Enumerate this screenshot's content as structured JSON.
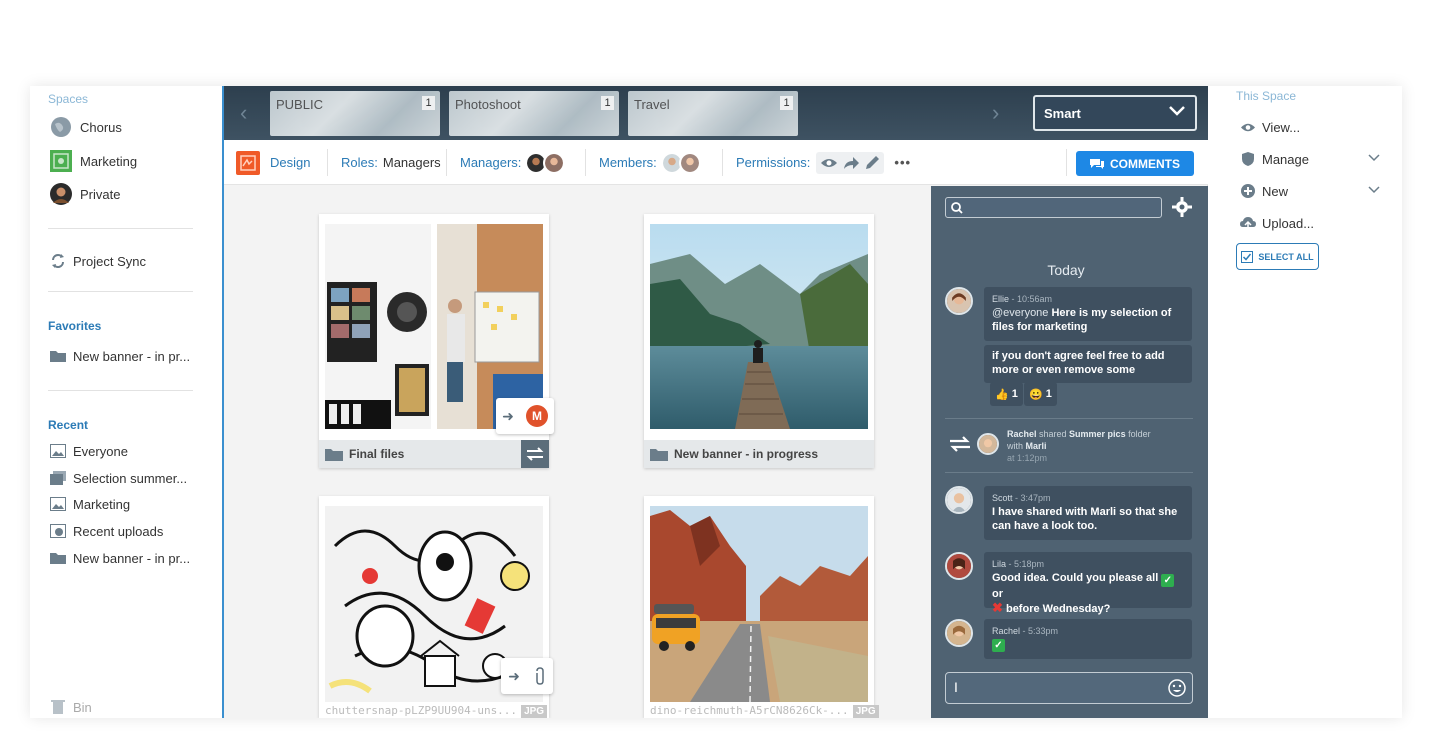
{
  "sidebar": {
    "spaces_heading": "Spaces",
    "spaces": [
      {
        "label": "Chorus",
        "icon": "globe-icon"
      },
      {
        "label": "Marketing",
        "icon": "marketing-space-icon"
      },
      {
        "label": "Private",
        "icon": "avatar"
      }
    ],
    "project_sync": "Project Sync",
    "favorites_heading": "Favorites",
    "favorites": [
      {
        "label": "New banner - in pr...",
        "icon": "folder-icon"
      }
    ],
    "recent_heading": "Recent",
    "recent": [
      {
        "label": "Everyone",
        "icon": "image-icon"
      },
      {
        "label": "Selection summer...",
        "icon": "stack-icon"
      },
      {
        "label": "Marketing",
        "icon": "image-icon"
      },
      {
        "label": "Recent uploads",
        "icon": "upload-clock-icon"
      },
      {
        "label": "New banner - in pr...",
        "icon": "folder-icon"
      }
    ],
    "bin": "Bin"
  },
  "tabs": [
    {
      "label": "PUBLIC",
      "count": "1"
    },
    {
      "label": "Photoshoot",
      "count": "1"
    },
    {
      "label": "Travel",
      "count": "1"
    }
  ],
  "view_select": {
    "value": "Smart"
  },
  "toolbar": {
    "space_name": "Design",
    "roles_label": "Roles:",
    "roles_value": "Managers",
    "managers_label": "Managers:",
    "members_label": "Members:",
    "permissions_label": "Permissions:",
    "more": "•••",
    "comments_button": "COMMENTS"
  },
  "cards": [
    {
      "name": "Final files",
      "type": "folder"
    },
    {
      "name": "New banner - in progress",
      "type": "folder"
    },
    {
      "name": "chuttersnap-pLZP9UU904-uns...",
      "badge": "JPG"
    },
    {
      "name": "dino-reichmuth-A5rCN8626Ck-...",
      "badge": "JPG"
    }
  ],
  "chat": {
    "search_placeholder": "",
    "day": "Today",
    "messages": [
      {
        "name": "Ellie",
        "time": " - 10:56am",
        "mention": "@everyone",
        "text": " Here is my selection of files for marketing"
      },
      {
        "text": "if you don't agree feel free to add more or even remove some"
      },
      {
        "name": "Scott",
        "time": " - 3:47pm",
        "text": "I have shared with Marli so that she can have a look too."
      },
      {
        "name": "Lila",
        "time": " - 5:18pm",
        "text1": "Good idea. Could you please all",
        "text2": "or",
        "text3": "before Wednesday?"
      },
      {
        "name": "Rachel",
        "time": " - 5:33pm"
      }
    ],
    "reactions": [
      {
        "emoji": "👍",
        "count": "1"
      },
      {
        "emoji": "😀",
        "count": "1"
      }
    ],
    "system": {
      "actor": "Rachel",
      "action": " shared ",
      "target": "Summer pics",
      "suffix": " folder",
      "with_label": "with ",
      "with_name": "Marli",
      "time": "at 1:12pm"
    }
  },
  "right_panel": {
    "heading": "This Space",
    "items": [
      {
        "label": "View...",
        "icon": "eye-icon"
      },
      {
        "label": "Manage",
        "icon": "shield-icon"
      },
      {
        "label": "New",
        "icon": "plus-icon"
      },
      {
        "label": "Upload...",
        "icon": "cloud-upload-icon"
      }
    ],
    "select_all": "SELECT ALL"
  }
}
